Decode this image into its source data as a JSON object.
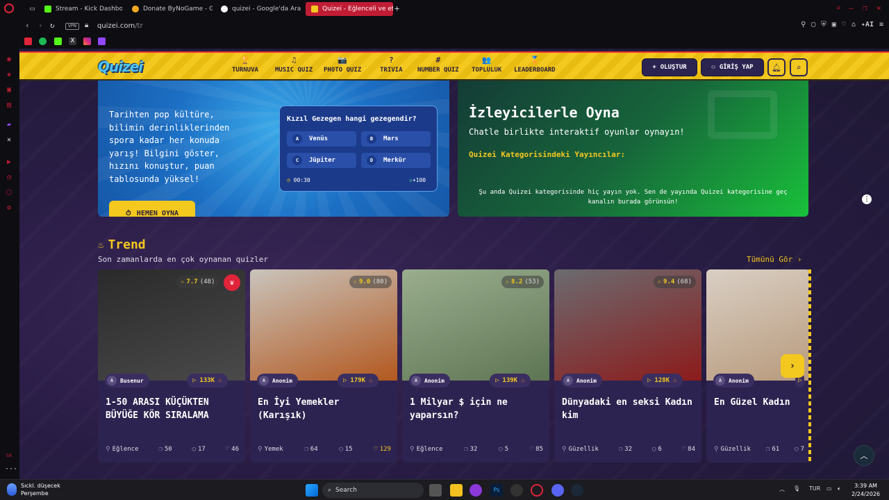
{
  "browser": {
    "tabs": [
      {
        "label": "Stream - Kick Dashboard",
        "color": "#53fc18"
      },
      {
        "label": "Donate ByNoGame - Gelen",
        "color": "#f3a91f"
      },
      {
        "label": "quizei - Google'da Ara",
        "color": "#ffffff"
      },
      {
        "label": "Quizei - Eğlenceli ve etkile",
        "color": "#f3c81f"
      }
    ],
    "new_tab": "+",
    "vpn": "VPN",
    "url_host": "quizei.com",
    "url_path": "/tr",
    "ai_label": "AI"
  },
  "header": {
    "logo": "Quizei",
    "nav": [
      {
        "label": "TURNUVA",
        "icon": "🏆"
      },
      {
        "label": "MUSIC QUIZ",
        "icon": "♫"
      },
      {
        "label": "PHOTO QUIZ",
        "icon": "📷"
      },
      {
        "label": "TRIVIA",
        "icon": "?"
      },
      {
        "label": "NUMBER QUIZ",
        "icon": "#"
      },
      {
        "label": "TOPLULUK",
        "icon": "👥"
      },
      {
        "label": "LEADERBOARD",
        "icon": "🏅"
      }
    ],
    "create_label": "OLUŞTUR",
    "login_label": "GİRİŞ YAP"
  },
  "hero_left": {
    "text": "Tarihten pop kültüre, bilimin derinliklerinden spora kadar her konuda yarış! Bilgini göster, hızını konuştur, puan tablosunda yüksel!",
    "button": "HEMEN OYNA",
    "quiz": {
      "question": "Kızıl Gezegen hangi gezegendir?",
      "options": [
        {
          "letter": "A",
          "label": "Venüs"
        },
        {
          "letter": "B",
          "label": "Mars"
        },
        {
          "letter": "C",
          "label": "Jüpiter"
        },
        {
          "letter": "D",
          "label": "Merkür"
        }
      ],
      "timer": "00:30",
      "points": "+100"
    }
  },
  "hero_right": {
    "title": "İzleyicilerle Oyna",
    "subtitle": "Chatle birlikte interaktif oyunlar oynayın!",
    "category_label": "Quizei Kategorisindeki Yayıncılar:",
    "empty_text": "Şu anda Quizei kategorisinde hiç yayın yok. Sen de yayında Quizei kategorisine geç kanalın burada görünsün!"
  },
  "trend": {
    "title": "Trend",
    "subtitle": "Son zamanlarda en çok oynanan quizler",
    "see_all": "Tümünü Gör",
    "cards": [
      {
        "rating": "7.7",
        "rating_count": "(48)",
        "author": "Busenur",
        "plays": "133K",
        "title": "1-50 ARASI KÜÇÜKTEN BÜYÜĞE KÖR SIRALAMA",
        "category": "Eğlence",
        "questions": "50",
        "comments": "17",
        "likes": "46",
        "img_colors": [
          "#2a2a2a",
          "#4a4a4a"
        ]
      },
      {
        "rating": "9.0",
        "rating_count": "(80)",
        "author": "Anonim",
        "plays": "179K",
        "title": "En İyi Yemekler (Karışık)",
        "category": "Yemek",
        "questions": "64",
        "comments": "15",
        "likes": "129",
        "img_colors": [
          "#c9c4bc",
          "#b3581f"
        ]
      },
      {
        "rating": "8.2",
        "rating_count": "(53)",
        "author": "Anonim",
        "plays": "139K",
        "title": "1 Milyar $ için ne yaparsın?",
        "category": "Eğlence",
        "questions": "32",
        "comments": "5",
        "likes": "85",
        "img_colors": [
          "#9aae8e",
          "#5e7554"
        ]
      },
      {
        "rating": "9.4",
        "rating_count": "(68)",
        "author": "Anonim",
        "plays": "128K",
        "title": "Dünyadaki en seksi Kadın kim",
        "category": "Güzellik",
        "questions": "32",
        "comments": "6",
        "likes": "84",
        "img_colors": [
          "#6b6b70",
          "#8c1b1b"
        ]
      },
      {
        "rating": "",
        "rating_count": "",
        "author": "Anonim",
        "plays": "",
        "title": "En Güzel Kadın",
        "category": "Güzellik",
        "questions": "61",
        "comments": "7",
        "likes": "",
        "img_colors": [
          "#d9cfc4",
          "#b89a7c"
        ]
      }
    ]
  },
  "taskbar": {
    "weather_line1": "Sıckl. düşecek",
    "weather_line2": "Perşembe",
    "search": "Search",
    "lang": "TUR",
    "time": "3:39 AM",
    "date": "2/24/2026"
  }
}
